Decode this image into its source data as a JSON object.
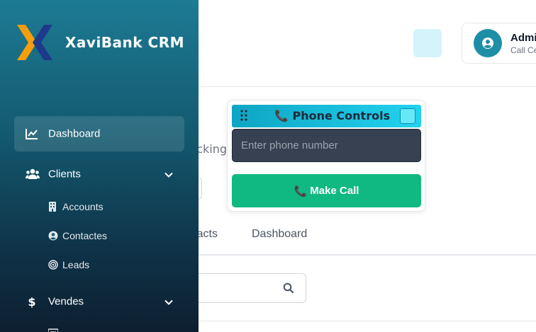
{
  "app": {
    "name": "XaviBank CRM"
  },
  "header": {
    "user_name": "Admin",
    "user_role": "Call Center",
    "user_icon": "user-circle-icon",
    "action_icon": "square-action-icon"
  },
  "main": {
    "subtitle_fragment": "Tracking",
    "tabs": [
      {
        "label": "Contacts"
      },
      {
        "label": "Dashboard"
      }
    ],
    "search_icon": "search-icon"
  },
  "phone_widget": {
    "title_emoji": "📞",
    "title": "Phone Controls",
    "input_placeholder": "Enter phone number",
    "input_value": "",
    "call_emoji": "📞",
    "call_label": "Make Call",
    "colors": {
      "header": "#22d3ee",
      "call_button": "#10b981",
      "input_bg": "#374151"
    }
  },
  "sidebar": {
    "items": [
      {
        "label": "Dashboard",
        "icon": "chart-line-icon",
        "active": true
      },
      {
        "label": "Clients",
        "icon": "users-icon",
        "expandable": true,
        "children": [
          {
            "label": "Accounts",
            "icon": "building-icon"
          },
          {
            "label": "Contactes",
            "icon": "user-circle-icon"
          },
          {
            "label": "Leads",
            "icon": "target-icon"
          }
        ]
      },
      {
        "label": "Vendes",
        "icon": "dollar-icon",
        "expandable": true
      }
    ],
    "colors": {
      "top": "#1d7b94",
      "bottom": "#0d1f30",
      "logo_orange": "#f59e0b",
      "logo_blue": "#1e3a8a"
    }
  }
}
